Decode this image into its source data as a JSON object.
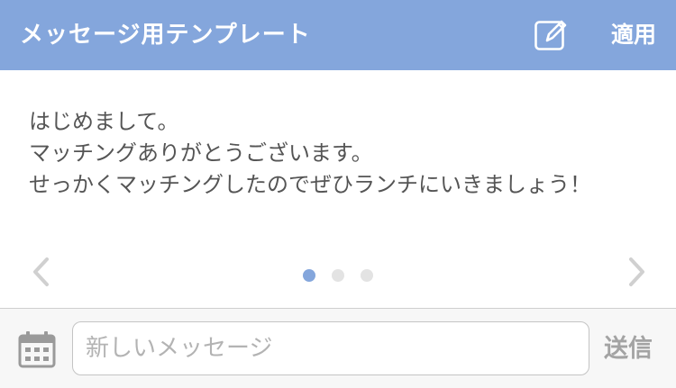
{
  "header": {
    "title": "メッセージ用テンプレート",
    "edit_icon": "edit-note-icon",
    "apply_label": "適用",
    "background_color": "#84a6dc"
  },
  "template": {
    "text": "はじめまして。\nマッチングありがとうございます。\nせっかくマッチングしたのでぜひランチにいきましょう！",
    "prev_icon": "chevron-left-icon",
    "next_icon": "chevron-right-icon",
    "pager": {
      "total": 3,
      "active": 1,
      "active_color": "#84a6dc",
      "inactive_color": "#e3e3e3"
    }
  },
  "composer": {
    "calendar_icon": "calendar-icon",
    "message_value": "",
    "message_placeholder": "新しいメッセージ",
    "send_label": "送信"
  }
}
